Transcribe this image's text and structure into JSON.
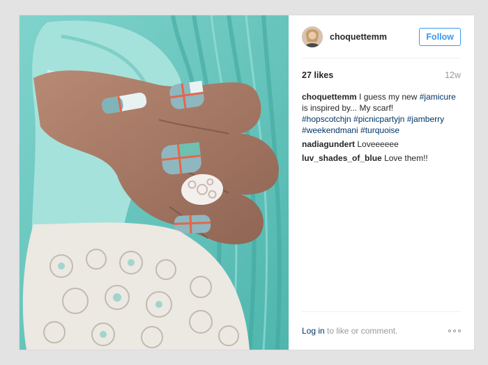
{
  "post": {
    "username": "choquettemm",
    "follow_label": "Follow",
    "likes": "27 likes",
    "age": "12w",
    "caption": {
      "user": "choquettemm",
      "text_before": "I guess my new",
      "tag1": "#jamicure",
      "text_after": "is inspired by... My scarf!",
      "tags_line1": "#hopscotchjn #picnicpartyjn #jamberry",
      "tags_line2": "#weekendmani #turquoise"
    },
    "comments": [
      {
        "user": "nadiagundert",
        "text": "Loveeeeee"
      },
      {
        "user": "luv_shades_of_blue",
        "text": "Love them!!"
      }
    ],
    "footer": {
      "login_label": "Log in",
      "login_suffix": "to like or comment."
    }
  },
  "icons": {
    "more": "more-options-icon"
  },
  "colors": {
    "accent": "#3897f0",
    "hashtag": "#003569",
    "muted": "#999999",
    "background": "#e3e3e3"
  }
}
